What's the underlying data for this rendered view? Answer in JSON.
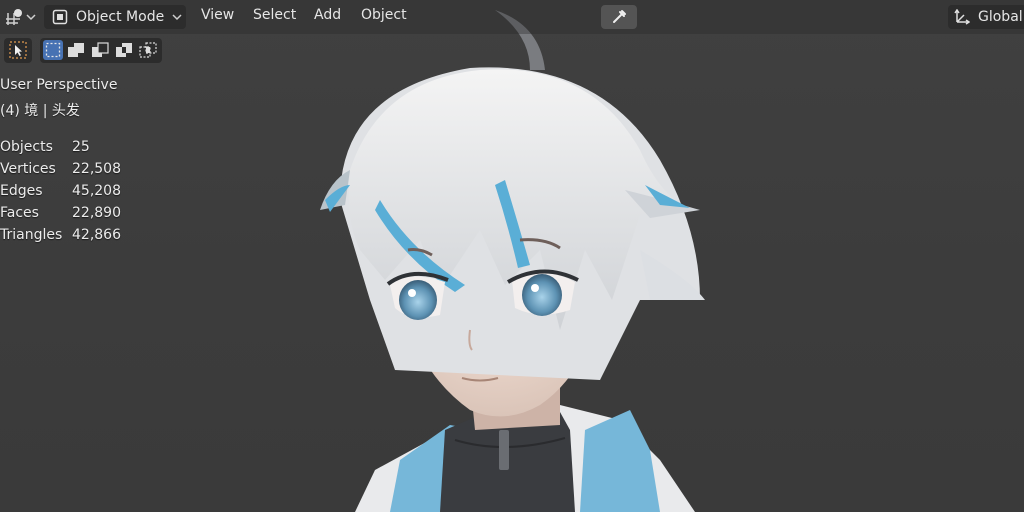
{
  "header": {
    "mode_selector": {
      "label": "Object Mode"
    },
    "menus": [
      "View",
      "Select",
      "Add",
      "Object"
    ],
    "transform_orientation": {
      "label": "Global"
    }
  },
  "viewport": {
    "perspective_label": "User Perspective",
    "active_object_label": "(4) 境 | 头发",
    "stats": [
      {
        "label": "Objects",
        "value": "25"
      },
      {
        "label": "Vertices",
        "value": "22,508"
      },
      {
        "label": "Edges",
        "value": "45,208"
      },
      {
        "label": "Faces",
        "value": "22,890"
      },
      {
        "label": "Triangles",
        "value": "42,866"
      }
    ]
  },
  "icons": {
    "editor_type": "object-gizmo-icon",
    "mode": "object-mode-icon",
    "eyedropper": "eyedropper-icon",
    "orientation": "transform-orientation-icon",
    "select_tool": "select-cursor-icon",
    "select_modes": [
      "select-new-icon",
      "select-extend-icon",
      "select-subtract-icon",
      "select-difference-icon",
      "select-intersect-icon"
    ]
  },
  "colors": {
    "viewport_bg": "#3d3d3d",
    "hair_accent": "#5aaed6",
    "eye_blue": "#6fa8c8",
    "hood_blue": "#5aaed6"
  }
}
